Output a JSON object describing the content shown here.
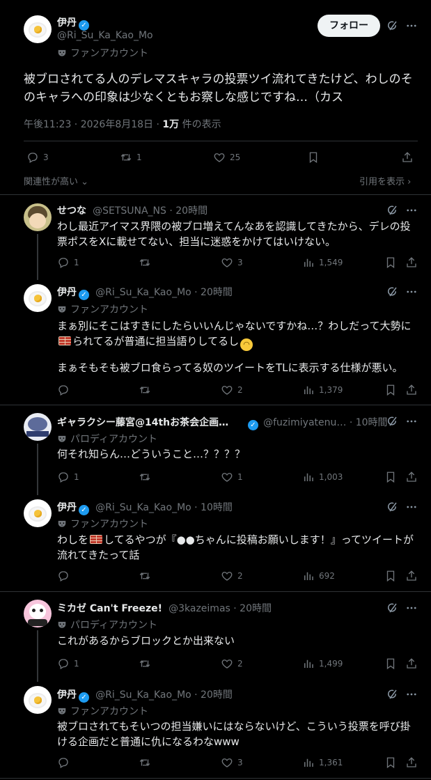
{
  "main_tweet": {
    "name": "伊丹",
    "handle": "@Ri_Su_Ka_Kao_Mo",
    "badge": "ファンアカウント",
    "follow_label": "フォロー",
    "text": "被ブロされてる人のデレマスキャラの投票ツイ流れてきたけど、わしのそのキャラへの印象は少なくともお察しな感じですね…（カス",
    "time": "午後11:23 · 2026年8月18日 · ",
    "views_count": "1万",
    "views_label": " 件の表示",
    "replies": "3",
    "retweets": "1",
    "likes": "25",
    "sort_label": "関連性が高い",
    "quote_label": "引用を表示"
  },
  "replies": [
    {
      "name": "せつな",
      "handle": "@SETSUNA_NS · 20時間",
      "text": "わし最近アイマス界隈の被ブロ増えてんなあを認識してきたから、デレの投票ポスをXに載せてない、担当に迷惑をかけてはいけない。",
      "replies": "1",
      "likes": "3",
      "views": "1,549"
    },
    {
      "name": "伊丹",
      "handle": "@Ri_Su_Ka_Kao_Mo · 20時間",
      "badge": "ファンアカウント",
      "text_1a": "まぁ別にそこはすきにしたらいいんじゃないですかね…？わしだって大勢に",
      "text_1b": "られてるが普通に担当語りしてるし",
      "text_2": "まぁそもそも被ブロ食らってる奴のツイートをTLに表示する仕様が悪い。",
      "likes": "2",
      "views": "1,379"
    },
    {
      "name": "ギャラクシー藤宮@14thお茶会企画…",
      "handle": "@fuzimiyatenu… · 10時間",
      "badge": "パロディアカウント",
      "text": "何それ知らん…どういうこと…？？？？",
      "replies": "1",
      "likes": "1",
      "views": "1,003"
    },
    {
      "name": "伊丹",
      "handle": "@Ri_Su_Ka_Kao_Mo · 10時間",
      "badge": "ファンアカウント",
      "text_a": "わしを",
      "text_b": "してるやつが『●●ちゃんに投稿お願いします！』ってツイートが流れてきたって話",
      "likes": "2",
      "views": "692"
    },
    {
      "name": "ミカゼ Can't Freeze!",
      "handle": "@3kazeimas · 20時間",
      "badge": "パロディアカウント",
      "text": "これがあるからブロックとか出来ない",
      "replies": "1",
      "likes": "2",
      "views": "1,499"
    },
    {
      "name": "伊丹",
      "handle": "@Ri_Su_Ka_Kao_Mo · 20時間",
      "badge": "ファンアカウント",
      "text": "被ブロされてもそいつの担当嫌いにはならないけど、こういう投票を呼び掛ける企画だと普通に仇になるわなwww",
      "likes": "3",
      "views": "1,361"
    }
  ],
  "colors": {
    "bg": "#000000",
    "text": "#e7e9ea",
    "dim": "#71767b",
    "border": "#2f3336",
    "verified": "#1d9bf0"
  }
}
